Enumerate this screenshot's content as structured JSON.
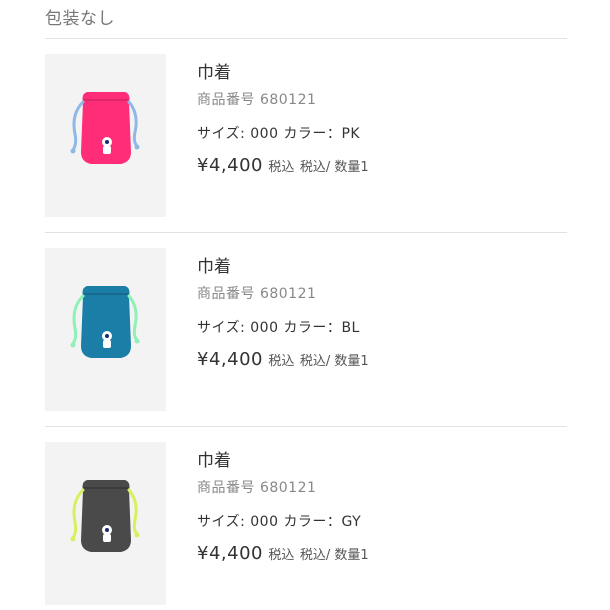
{
  "section_title": "包装なし",
  "items": [
    {
      "name": "巾着",
      "number_label": "商品番号",
      "number": "680121",
      "size_label": "サイズ:",
      "size": "000",
      "color_label": "カラー：",
      "color_code": "PK",
      "price": "¥4,400",
      "tax_note": "税込",
      "qty_text": "税込/ 数量1",
      "bag_color": "#ff2d78",
      "cord_color": "#8fb8e6"
    },
    {
      "name": "巾着",
      "number_label": "商品番号",
      "number": "680121",
      "size_label": "サイズ:",
      "size": "000",
      "color_label": "カラー：",
      "color_code": "BL",
      "price": "¥4,400",
      "tax_note": "税込",
      "qty_text": "税込/ 数量1",
      "bag_color": "#1a7ea6",
      "cord_color": "#8ff0b8"
    },
    {
      "name": "巾着",
      "number_label": "商品番号",
      "number": "680121",
      "size_label": "サイズ:",
      "size": "000",
      "color_label": "カラー：",
      "color_code": "GY",
      "price": "¥4,400",
      "tax_note": "税込",
      "qty_text": "税込/ 数量1",
      "bag_color": "#4a4a4a",
      "cord_color": "#d8f060"
    }
  ]
}
